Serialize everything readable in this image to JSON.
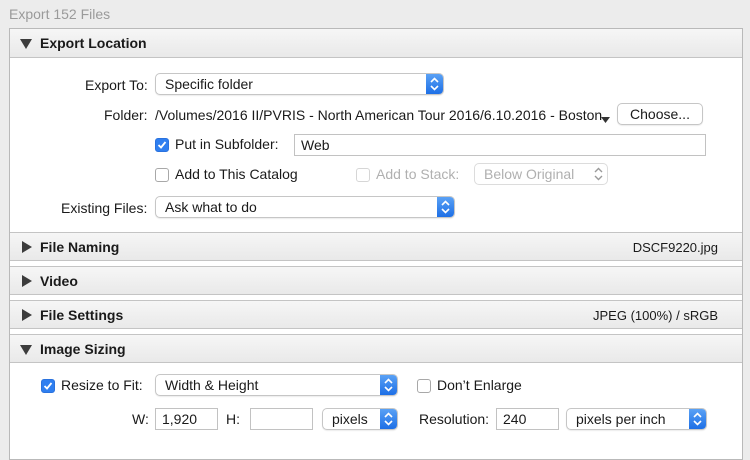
{
  "window": {
    "title": "Export 152 Files"
  },
  "colors": {
    "accent": "#2f7ff0",
    "header_bg": "#eeeeee",
    "panel_bg": "#ffffff"
  },
  "export_location": {
    "header": "Export Location",
    "export_to_label": "Export To:",
    "export_to_value": "Specific folder",
    "folder_label": "Folder:",
    "folder_path": "/Volumes/2016 II/PVRIS - North American Tour 2016/6.10.2016 - Boston",
    "choose_button": "Choose...",
    "subfolder_checkbox_label": "Put in Subfolder:",
    "subfolder_checked": true,
    "subfolder_name": "Web",
    "add_catalog_label": "Add to This Catalog",
    "add_catalog_checked": false,
    "add_stack_label": "Add to Stack:",
    "add_stack_checked": false,
    "stack_position": "Below Original",
    "existing_files_label": "Existing Files:",
    "existing_files_value": "Ask what to do"
  },
  "file_naming": {
    "header": "File Naming",
    "summary": "DSCF9220.jpg"
  },
  "video": {
    "header": "Video"
  },
  "file_settings": {
    "header": "File Settings",
    "summary": "JPEG (100%) / sRGB"
  },
  "image_sizing": {
    "header": "Image Sizing",
    "resize_label": "Resize to Fit:",
    "resize_checked": true,
    "resize_mode": "Width & Height",
    "dont_enlarge_label": "Don’t Enlarge",
    "dont_enlarge_checked": false,
    "w_label": "W:",
    "w_value": "1,920",
    "h_label": "H:",
    "h_value": "",
    "unit": "pixels",
    "resolution_label": "Resolution:",
    "resolution_value": "240",
    "resolution_unit": "pixels per inch"
  }
}
